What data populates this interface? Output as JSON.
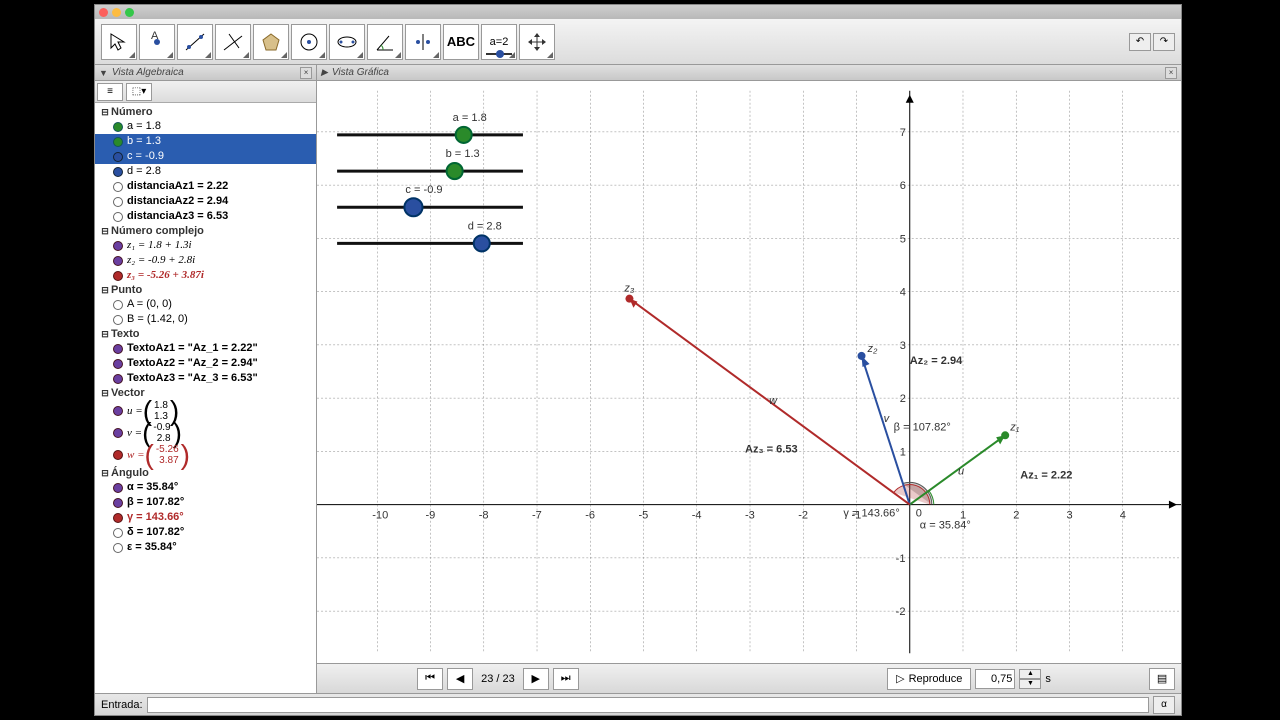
{
  "window": {
    "title": ""
  },
  "toolbar": {
    "tools": [
      "move",
      "point",
      "line",
      "perpendicular",
      "polygon",
      "circle",
      "ellipse",
      "angle",
      "reflect",
      "text",
      "slider",
      "move-view"
    ]
  },
  "panels": {
    "algebra_title": "Vista Algebraica",
    "graphics_title": "Vista Gráfica"
  },
  "tree": {
    "numero": {
      "label": "Número",
      "items": [
        {
          "name": "a",
          "val": "a = 1.8",
          "color": "green"
        },
        {
          "name": "b",
          "val": "b = 1.3",
          "color": "green",
          "sel": true
        },
        {
          "name": "c",
          "val": "c = -0.9",
          "color": "blue",
          "sel": true
        },
        {
          "name": "d",
          "val": "d = 2.8",
          "color": "blue"
        },
        {
          "name": "distanciaAz1",
          "val": "distanciaAz1 = 2.22",
          "color": "open"
        },
        {
          "name": "distanciaAz2",
          "val": "distanciaAz2 = 2.94",
          "color": "open"
        },
        {
          "name": "distanciaAz3",
          "val": "distanciaAz3 = 6.53",
          "color": "open"
        }
      ]
    },
    "complejo": {
      "label": "Número complejo",
      "items": [
        {
          "name": "z1",
          "val": "z₁ = 1.8 + 1.3i",
          "color": "filled-purple"
        },
        {
          "name": "z2",
          "val": "z₂ = -0.9 + 2.8i",
          "color": "filled-purple"
        },
        {
          "name": "z3",
          "val": "z₃ = -5.26 + 3.87i",
          "color": "red"
        }
      ]
    },
    "punto": {
      "label": "Punto",
      "items": [
        {
          "name": "A",
          "val": "A = (0, 0)",
          "color": "open"
        },
        {
          "name": "B",
          "val": "B = (1.42, 0)",
          "color": "open"
        }
      ]
    },
    "texto": {
      "label": "Texto",
      "items": [
        {
          "name": "TextoAz1",
          "val": "TextoAz1 = \"Az_1 = 2.22\"",
          "color": "filled-purple"
        },
        {
          "name": "TextoAz2",
          "val": "TextoAz2 = \"Az_2 = 2.94\"",
          "color": "filled-purple"
        },
        {
          "name": "TextoAz3",
          "val": "TextoAz3 = \"Az_3 = 6.53\"",
          "color": "filled-purple"
        }
      ]
    },
    "vector": {
      "label": "Vector",
      "items": [
        {
          "name": "u",
          "x": "1.8",
          "y": "1.3",
          "color": "filled-purple"
        },
        {
          "name": "v",
          "x": "-0.9",
          "y": "2.8",
          "color": "filled-purple"
        },
        {
          "name": "w",
          "x": "-5.26",
          "y": "3.87",
          "color": "red"
        }
      ]
    },
    "angulo": {
      "label": "Ángulo",
      "items": [
        {
          "name": "alpha",
          "val": "α = 35.84°",
          "color": "filled-purple"
        },
        {
          "name": "beta",
          "val": "β = 107.82°",
          "color": "filled-purple"
        },
        {
          "name": "gamma",
          "val": "γ = 143.66°",
          "color": "red"
        },
        {
          "name": "delta",
          "val": "δ = 107.82°",
          "color": "open"
        },
        {
          "name": "epsilon",
          "val": "ε = 35.84°",
          "color": "open"
        }
      ]
    }
  },
  "sliders": {
    "a": {
      "label": "a = 1.8",
      "pos": 0.68,
      "color": "g"
    },
    "b": {
      "label": "b = 1.3",
      "pos": 0.63,
      "color": "g"
    },
    "c": {
      "label": "c = -0.9",
      "pos": 0.41,
      "color": "b"
    },
    "d": {
      "label": "d = 2.8",
      "pos": 0.78,
      "color": "b"
    }
  },
  "graph_labels": {
    "z1": "z₁",
    "z2": "z₂",
    "z3": "z₃",
    "az1": "Az₁ = 2.22",
    "az2": "Az₂ = 2.94",
    "az3": "Az₃ = 6.53",
    "alpha": "α = 35.84°",
    "beta": "β = 107.82°",
    "gamma": "γ = 143.66°",
    "u": "u",
    "v": "v",
    "w": "w"
  },
  "axis_x": [
    "-10",
    "-9",
    "-8",
    "-7",
    "-6",
    "-5",
    "-4",
    "-3",
    "-2",
    "-1",
    "0",
    "1",
    "2",
    "3",
    "4"
  ],
  "axis_y": [
    "-2",
    "-1",
    "1",
    "2",
    "3",
    "4",
    "5",
    "6",
    "7"
  ],
  "nav": {
    "step": "23 / 23",
    "play": "Reproduce",
    "speed": "0,75",
    "mult": "s"
  },
  "input": {
    "label": "Entrada:"
  },
  "chart_data": {
    "type": "scatter",
    "title": "",
    "xlabel": "",
    "ylabel": "",
    "xlim": [
      -10.5,
      4.5
    ],
    "ylim": [
      -2.5,
      7.5
    ],
    "origin": [
      0,
      0
    ],
    "points": {
      "A": [
        0,
        0
      ],
      "B": [
        1.42,
        0
      ],
      "z1": [
        1.8,
        1.3
      ],
      "z2": [
        -0.9,
        2.8
      ],
      "z3": [
        -5.26,
        3.87
      ]
    },
    "vectors": {
      "u": [
        1.8,
        1.3
      ],
      "v": [
        -0.9,
        2.8
      ],
      "w": [
        -5.26,
        3.87
      ]
    },
    "angles": {
      "alpha": 35.84,
      "beta": 107.82,
      "gamma": 143.66,
      "delta": 107.82,
      "epsilon": 35.84
    },
    "distances": {
      "Az1": 2.22,
      "Az2": 2.94,
      "Az3": 6.53
    },
    "sliders": {
      "a": 1.8,
      "b": 1.3,
      "c": -0.9,
      "d": 2.8
    }
  }
}
